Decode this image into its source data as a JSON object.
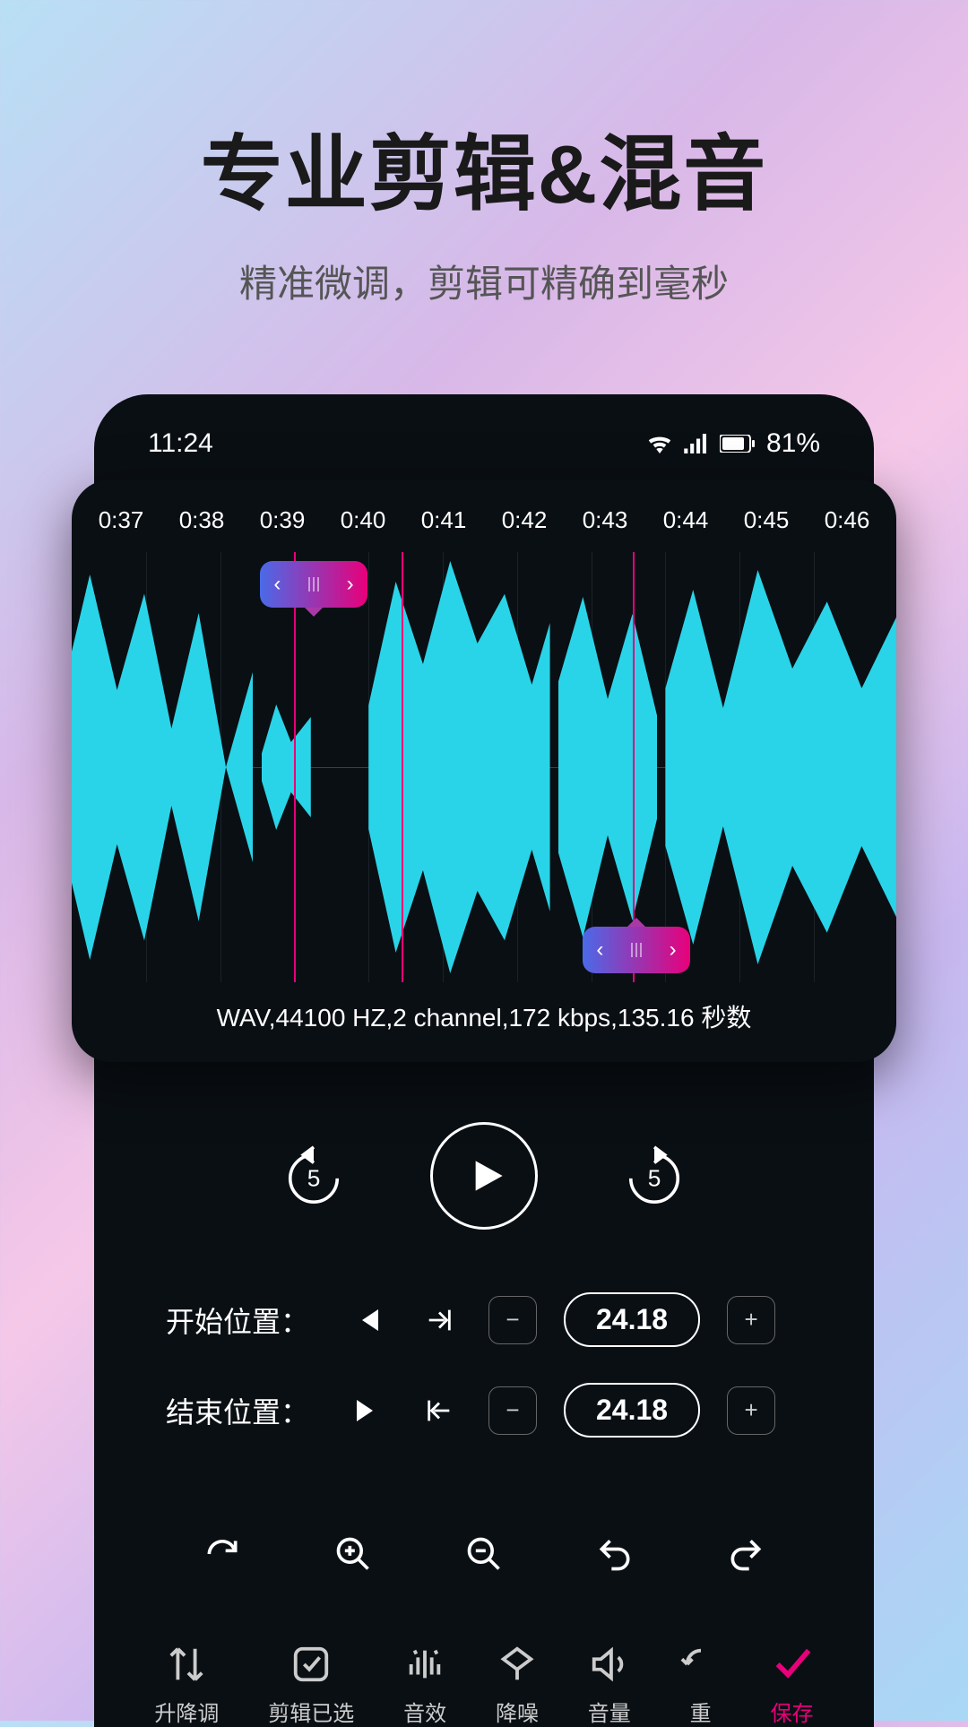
{
  "heading": {
    "title": "专业剪辑&混音",
    "subtitle": "精准微调，剪辑可精确到毫秒"
  },
  "statusbar": {
    "time": "11:24",
    "battery": "81%"
  },
  "timeline": [
    "0:37",
    "0:38",
    "0:39",
    "0:40",
    "0:41",
    "0:42",
    "0:43",
    "0:44",
    "0:45",
    "0:46"
  ],
  "fileinfo": "WAV,44100 HZ,2 channel,172 kbps,135.16 秒数",
  "skip_back": "5",
  "skip_fwd": "5",
  "positions": {
    "start": {
      "label": "开始位置：",
      "value": "24.18"
    },
    "end": {
      "label": "结束位置：",
      "value": "24.18"
    }
  },
  "tools": {
    "pitch": "升降调",
    "clip": "剪辑已选",
    "effect": "音效",
    "denoise": "降噪",
    "volume": "音量",
    "repeat": "重",
    "save": "保存"
  },
  "colors": {
    "accent": "#e8007a",
    "wave": "#2ad4e8"
  }
}
